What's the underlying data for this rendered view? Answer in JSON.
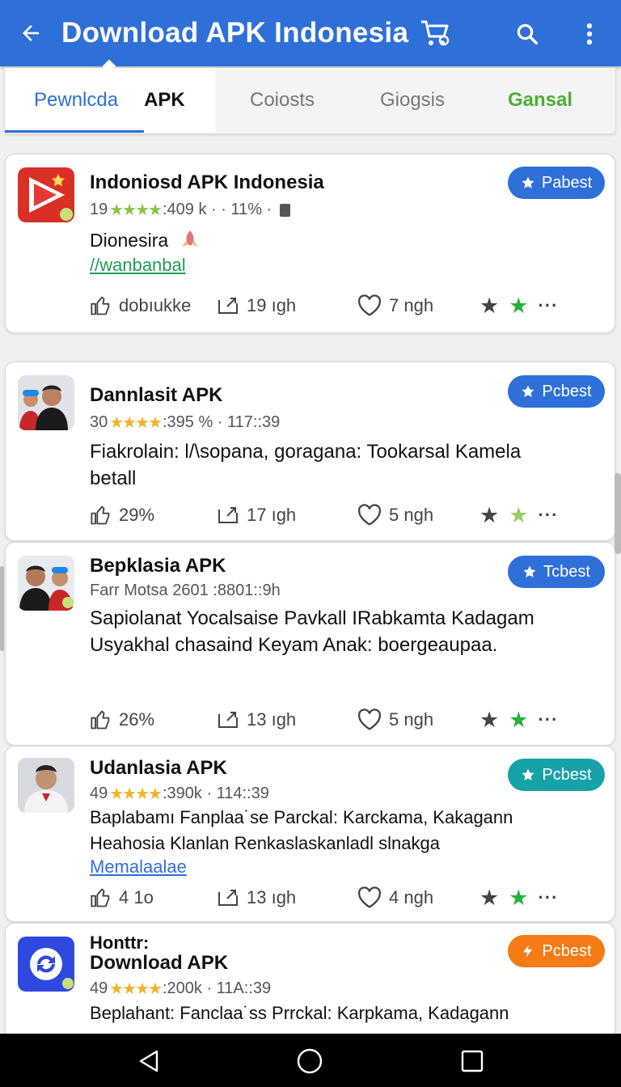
{
  "app_bar": {
    "title": "Download APK Indonesia"
  },
  "tabs": [
    "Pewnlcda",
    "APK",
    "Coiosts",
    "Giogsis",
    "Gansal"
  ],
  "cards": [
    {
      "title": "Indoniosd APK Indonesia",
      "meta": {
        "rating": "19",
        "stars": "★★★★",
        "stat": ":409 k · · 11% ·"
      },
      "sub": "Dionesira",
      "link": "//wanbanbal",
      "badge": "Pabest",
      "badge_color": "#2f6fd8",
      "actions": {
        "like": "dobıukke",
        "share": "19 ıgh",
        "fav": "7 ngh"
      }
    },
    {
      "title": "Dannlasit APK",
      "meta": {
        "rating": "30",
        "stars": "★★★★",
        "stat": ":395 % · 117::39"
      },
      "desc": "Fiakrolain: l/\\sopana, goragana: Tookarsal Kamela betall",
      "badge": "Pcbest",
      "badge_color": "#2f6fd8",
      "actions": {
        "like": "29%",
        "share": "17 ıgh",
        "fav": "5 ngh"
      }
    },
    {
      "title": "Bepklasia APK",
      "meta": {
        "rating": "Farr Motsa 2601 :8801::9h"
      },
      "desc": "Sapiolanat Yocalsaise Pavkall IRabkamta Kadagam Usyakhal chasaind Keyam Anak: boergeaupaa.",
      "badge": "Tcbest",
      "badge_color": "#2f6fd8",
      "actions": {
        "like": "26%",
        "share": "13 ıgh",
        "fav": "5 ngh"
      }
    },
    {
      "title": "Udanlasia APK",
      "meta": {
        "rating": "49",
        "stars": "★★★★",
        "stat": ":390k · 114::39"
      },
      "desc": "Baplabamı Fanplaa˙se Parckal: Karckama, Kakagann Heahosia Klanlan Renkaslaskanladl slnakga",
      "link": "Memalaalae",
      "badge": "Pcbest",
      "badge_color": "#17a2a8",
      "actions": {
        "like": "4 1o",
        "share": "13 ıgh",
        "fav": "4 ngh"
      }
    },
    {
      "title": "Honttr:",
      "title2": "Download APK",
      "meta": {
        "rating": "49",
        "stars": "★★★★",
        "stat": ":200k · 11A::39"
      },
      "desc": "Beplahant: Fanclaa˙ss Prrckal: Karpkama, Kadagann",
      "badge": "Pcbest",
      "badge_color": "#f47b16"
    }
  ],
  "colors": {
    "primary": "#2f6fd8",
    "accent_green": "#22b23b",
    "teal": "#17a2a8",
    "orange": "#f47b16"
  }
}
